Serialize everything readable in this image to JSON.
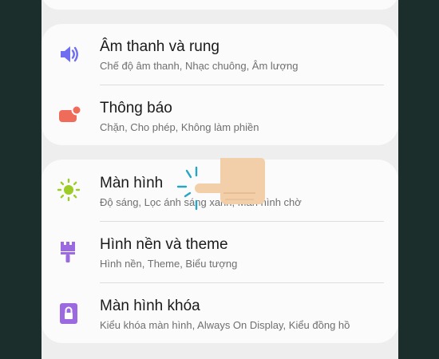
{
  "settings": {
    "sound": {
      "title": "Âm thanh và rung",
      "subtitle": "Chế độ âm thanh, Nhạc chuông, Âm lượng",
      "icon": "speaker-icon",
      "icon_color": "#6f6ef0"
    },
    "notifications": {
      "title": "Thông báo",
      "subtitle": "Chặn, Cho phép, Không làm phiền",
      "icon": "notification-icon",
      "icon_color": "#ef6b5a"
    },
    "display": {
      "title": "Màn hình",
      "subtitle": "Độ sáng, Lọc ánh sáng xanh, Màn hình chờ",
      "icon": "brightness-icon",
      "icon_color": "#9ccc25"
    },
    "wallpaper": {
      "title": "Hình nền và theme",
      "subtitle": "Hình nền, Theme, Biểu tượng",
      "icon": "paintbrush-icon",
      "icon_color": "#9b6ae0"
    },
    "lock_screen": {
      "title": "Màn hình khóa",
      "subtitle": "Kiểu khóa màn hình, Always On Display, Kiểu đồng hồ",
      "icon": "lock-icon",
      "icon_color": "#9b6ae0"
    }
  },
  "tap_indicator_color": "#26a6c4"
}
